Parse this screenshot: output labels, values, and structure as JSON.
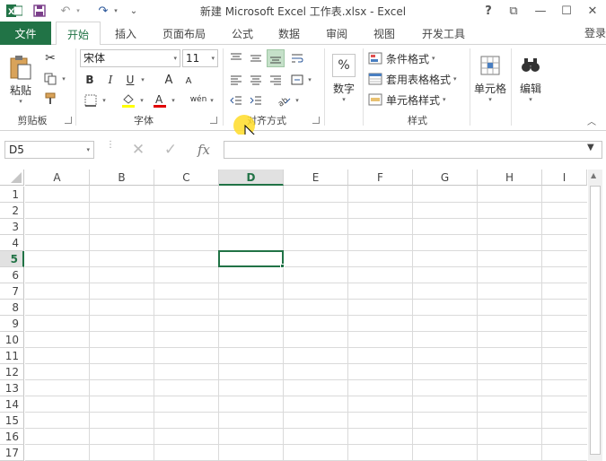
{
  "window": {
    "title": "新建 Microsoft Excel 工作表.xlsx - Excel",
    "help_label": "?",
    "controls": [
      "⧉",
      "—",
      "☐",
      "✕"
    ]
  },
  "quick_access": {
    "undo": "↶",
    "redo": "↷",
    "customize": "⌄"
  },
  "tabs": {
    "file": "文件",
    "items": [
      "开始",
      "插入",
      "页面布局",
      "公式",
      "数据",
      "审阅",
      "视图",
      "开发工具"
    ],
    "active_index": 0,
    "login": "登录"
  },
  "ribbon": {
    "clipboard": {
      "label": "剪贴板",
      "paste": "粘贴"
    },
    "font": {
      "label": "字体",
      "font_name": "宋体",
      "font_size": "11",
      "bold": "B",
      "italic": "I",
      "underline": "U",
      "grow": "A",
      "shrink": "A",
      "phonetic": "wén"
    },
    "alignment": {
      "label": "对齐方式"
    },
    "number": {
      "label": "数字",
      "icon": "%"
    },
    "styles": {
      "label": "样式",
      "conditional": "条件格式",
      "table": "套用表格格式",
      "cell_styles": "单元格样式"
    },
    "cells": {
      "label": "单元格"
    },
    "editing": {
      "label": "编辑"
    }
  },
  "formula_bar": {
    "name_box": "D5",
    "cancel": "✕",
    "enter": "✓",
    "fx": "fx",
    "value": ""
  },
  "sheet": {
    "columns": [
      "A",
      "B",
      "C",
      "D",
      "E",
      "F",
      "G",
      "H",
      "I"
    ],
    "rows": [
      "1",
      "2",
      "3",
      "4",
      "5",
      "6",
      "7",
      "8",
      "9",
      "10",
      "11",
      "12",
      "13",
      "14",
      "15",
      "16",
      "17"
    ],
    "selected_column": "D",
    "selected_row": "5"
  },
  "colors": {
    "accent": "#217346"
  }
}
